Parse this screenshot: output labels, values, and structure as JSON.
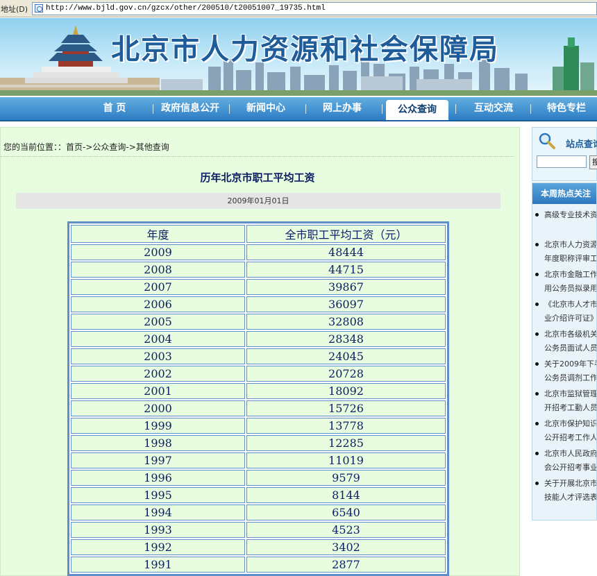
{
  "address_bar": {
    "label": "地址(D)",
    "url": "http://www.bjld.gov.cn/gzcx/other/200510/t20051007_19735.html"
  },
  "banner": {
    "title": "北京市人力资源和社会保障局"
  },
  "nav": {
    "items": [
      "首 页",
      "政府信息公开",
      "新闻中心",
      "网上办事",
      "公众查询",
      "互动交流",
      "特色专栏"
    ],
    "active": "公众查询"
  },
  "breadcrumb": "您的当前位置：：首页->公众查询->其他查询",
  "article": {
    "title": "历年北京市职工平均工资",
    "date": "2009年01月01日",
    "table": {
      "headers": [
        "年度",
        "全市职工平均工资（元）"
      ],
      "rows": [
        [
          "2009",
          "48444"
        ],
        [
          "2008",
          "44715"
        ],
        [
          "2007",
          "39867"
        ],
        [
          "2006",
          "36097"
        ],
        [
          "2005",
          "32808"
        ],
        [
          "2004",
          "28348"
        ],
        [
          "2003",
          "24045"
        ],
        [
          "2002",
          "20728"
        ],
        [
          "2001",
          "18092"
        ],
        [
          "2000",
          "15726"
        ],
        [
          "1999",
          "13778"
        ],
        [
          "1998",
          "12285"
        ],
        [
          "1997",
          "11019"
        ],
        [
          "1996",
          "9579"
        ],
        [
          "1995",
          "8144"
        ],
        [
          "1994",
          "6540"
        ],
        [
          "1993",
          "4523"
        ],
        [
          "1992",
          "3402"
        ],
        [
          "1991",
          "2877"
        ]
      ]
    }
  },
  "sidebar": {
    "search_title": "站点查询",
    "search_button": "搜",
    "hot_title": "本周热点关注",
    "hot_items": [
      [
        "高级专业技术资"
      ],
      [
        "北京市人力资源",
        "年度职称评审工"
      ],
      [
        "北京市金融工作",
        "用公务员拟录用"
      ],
      [
        "《北京市人才市",
        "业介绍许可证》"
      ],
      [
        "北京市各级机关",
        "公务员面试人员"
      ],
      [
        "关于2009年下半",
        "公务员调剂工作"
      ],
      [
        "北京市监狱管理",
        "开招考工勤人员"
      ],
      [
        "北京市保护知识",
        "公开招考工作人"
      ],
      [
        "北京市人民政府",
        "会公开招考事业"
      ],
      [
        "关于开展北京市",
        "技能人才评选表"
      ]
    ]
  }
}
